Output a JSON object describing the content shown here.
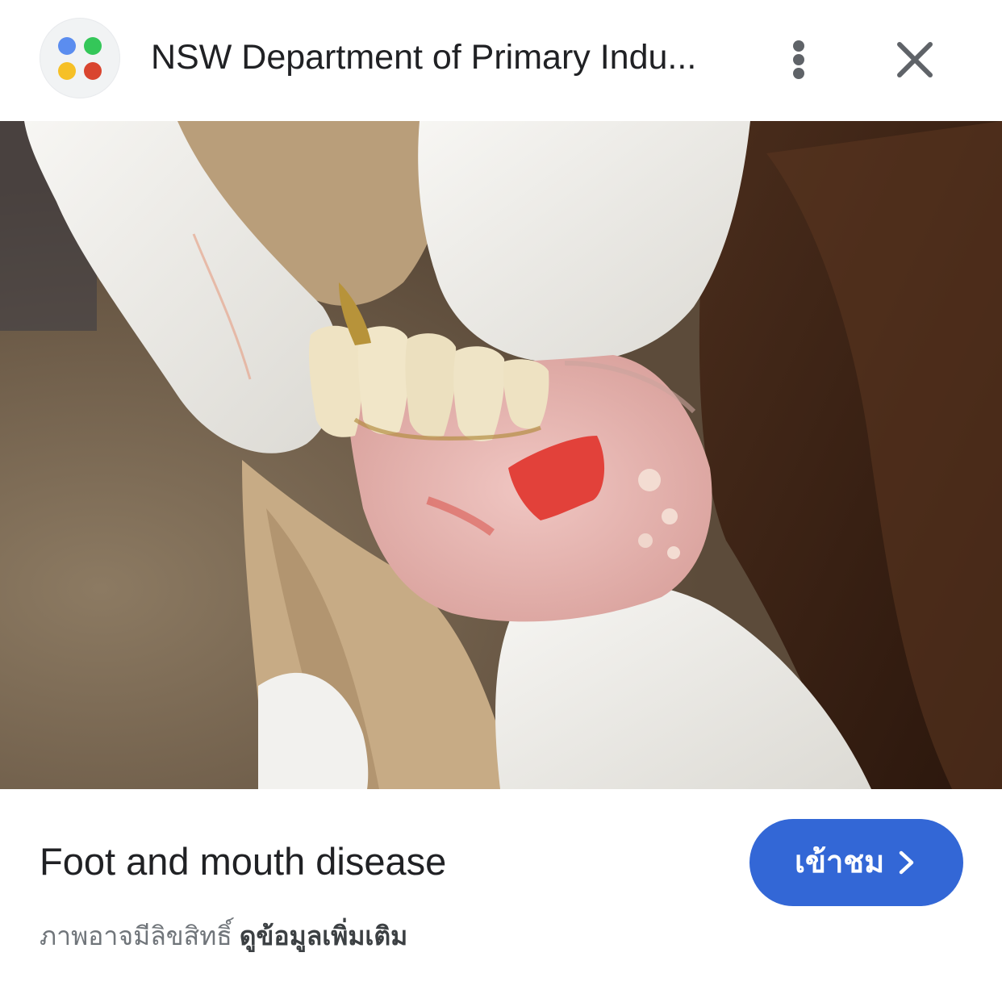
{
  "header": {
    "source_title": "NSW Department of Primary Indu...",
    "site_icon": "four-color-dots-icon",
    "menu_icon": "vertical-dots-icon",
    "close_icon": "close-icon"
  },
  "image": {
    "subject": "image-preview"
  },
  "caption": {
    "title": "Foot and mouth disease"
  },
  "visit_button": {
    "label": "เข้าชม",
    "icon": "chevron-right-icon"
  },
  "footer": {
    "copyright_text": "ภาพอาจมีลิขสิทธิ์",
    "learn_more_label": "ดูข้อมูลเพิ่มเติม"
  },
  "colors": {
    "accent_blue": "#3367d6",
    "icon_blue": "#5b8def",
    "icon_green": "#34c759",
    "icon_yellow": "#f6c026",
    "icon_red": "#d9452f",
    "text_primary": "#202124",
    "text_secondary": "#70757a"
  }
}
